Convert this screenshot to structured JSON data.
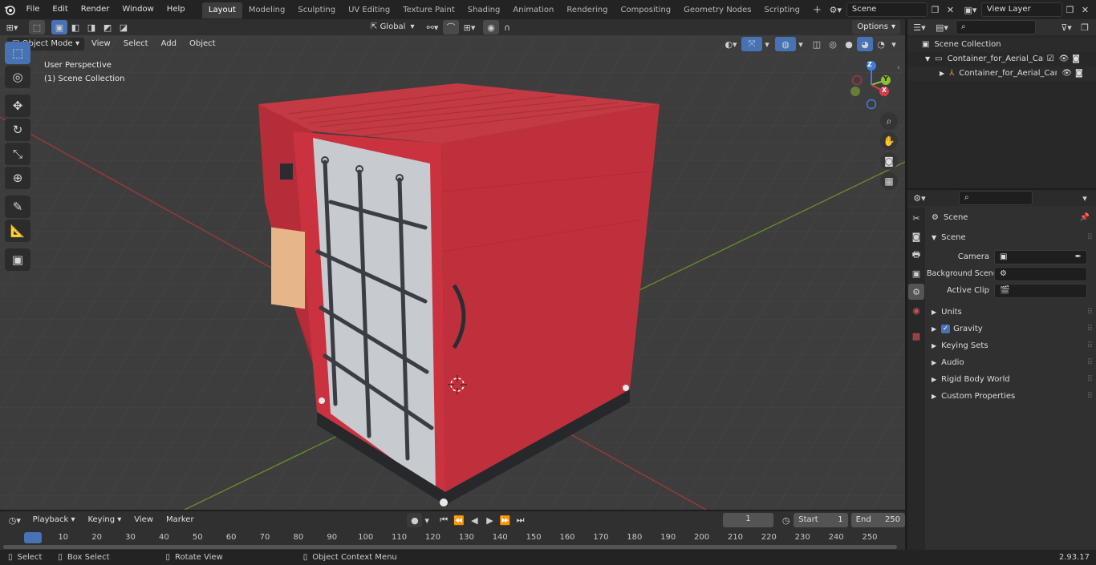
{
  "menu": {
    "items": [
      "File",
      "Edit",
      "Render",
      "Window",
      "Help"
    ]
  },
  "workspaces": {
    "tabs": [
      "Layout",
      "Modeling",
      "Sculpting",
      "UV Editing",
      "Texture Paint",
      "Shading",
      "Animation",
      "Rendering",
      "Compositing",
      "Geometry Nodes",
      "Scripting"
    ],
    "active": "Layout",
    "add": "+"
  },
  "scene": {
    "name": "Scene",
    "view_layer": "View Layer"
  },
  "viewport": {
    "mode": "Object Mode",
    "menus": [
      "View",
      "Select",
      "Add",
      "Object"
    ],
    "transform_orientation": "Global",
    "options_label": "Options",
    "perspective_label": "User Perspective",
    "collection_label": "(1) Scene Collection",
    "gizmo": {
      "x": "X",
      "y": "Y",
      "z": "Z"
    }
  },
  "outliner": {
    "root": "Scene Collection",
    "items": [
      {
        "label": "Container_for_Aerial_Cargo_F"
      },
      {
        "label": "Container_for_Aerial_Car"
      }
    ]
  },
  "properties": {
    "header": "Scene",
    "section": "Scene",
    "fields": [
      {
        "label": "Camera"
      },
      {
        "label": "Background Scene"
      },
      {
        "label": "Active Clip"
      }
    ],
    "panels": [
      "Units",
      "Gravity",
      "Keying Sets",
      "Audio",
      "Rigid Body World",
      "Custom Properties"
    ],
    "gravity_checked": true
  },
  "timeline": {
    "menus": [
      "Playback",
      "Keying",
      "View",
      "Marker"
    ],
    "current_frame": "1",
    "start_label": "Start",
    "start": "1",
    "end_label": "End",
    "end": "250",
    "ticks": [
      "1",
      "10",
      "20",
      "30",
      "40",
      "50",
      "60",
      "70",
      "80",
      "90",
      "100",
      "110",
      "120",
      "130",
      "140",
      "150",
      "160",
      "170",
      "180",
      "190",
      "200",
      "210",
      "220",
      "230",
      "240",
      "250"
    ]
  },
  "status": {
    "items": [
      "Select",
      "Box Select",
      "Rotate View",
      "Object Context Menu"
    ],
    "version": "2.93.17"
  },
  "colors": {
    "accent": "#4772b3",
    "container_red": "#c0303c",
    "header": "#232323"
  }
}
